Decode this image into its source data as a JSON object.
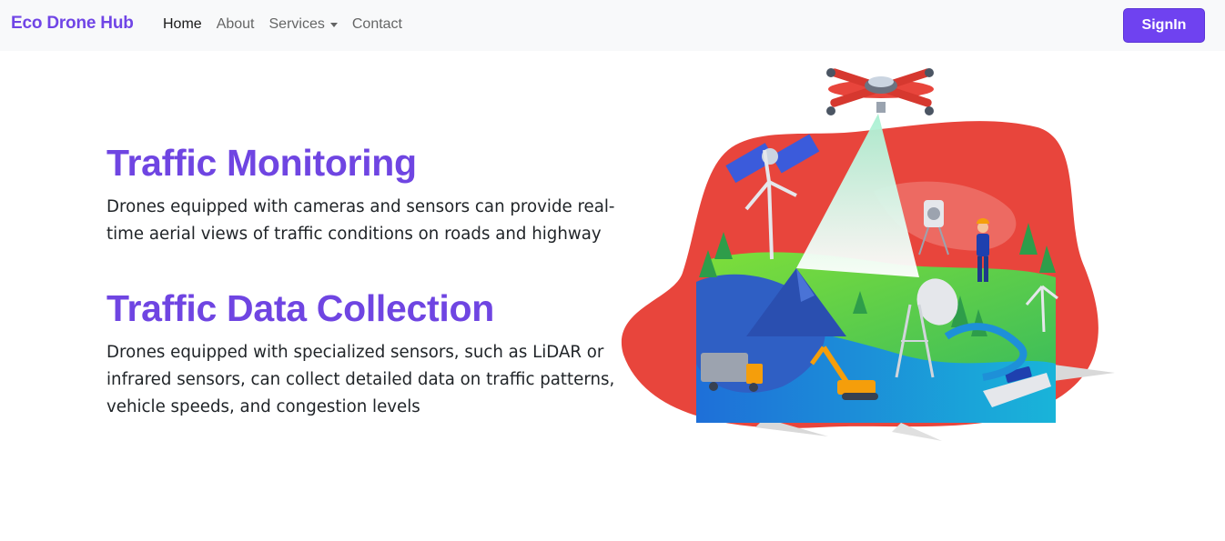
{
  "navbar": {
    "brand": "Eco Drone Hub",
    "links": [
      {
        "label": "Home",
        "active": true
      },
      {
        "label": "About"
      },
      {
        "label": "Services",
        "dropdown": true
      },
      {
        "label": "Contact"
      }
    ],
    "signin_label": "SignIn"
  },
  "sections": [
    {
      "title": "Traffic Monitoring",
      "text": "Drones equipped with cameras and sensors can provide real-time aerial views of traffic conditions on roads and highway"
    },
    {
      "title": "Traffic Data Collection",
      "text": "Drones equipped with specialized sensors, such as LiDAR or infrared sensors, can collect detailed data on traffic patterns, vehicle speeds, and congestion levels"
    }
  ],
  "colors": {
    "brand": "#7045e6",
    "button": "#6f42f0",
    "heading": "#6f45e2",
    "blob": "#e8453c"
  }
}
